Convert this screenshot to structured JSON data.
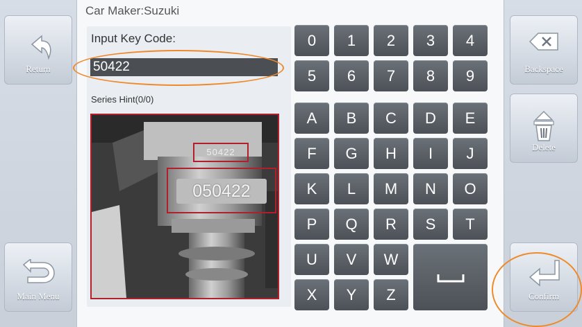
{
  "sidebar_left": {
    "return_label": "Return",
    "main_menu_label": "Main Menu"
  },
  "sidebar_right": {
    "backspace_label": "Backspace",
    "delete_label": "Delete",
    "confirm_label": "Confirm"
  },
  "header": {
    "car_maker": "Car Maker:Suzuki"
  },
  "form": {
    "key_code_label": "Input Key Code:",
    "key_code_value": "50422",
    "series_hint": "Series Hint(0/0)"
  },
  "photo": {
    "small_code": "50422",
    "large_code": "050422"
  },
  "keyboard": {
    "digits": [
      "0",
      "1",
      "2",
      "3",
      "4",
      "5",
      "6",
      "7",
      "8",
      "9"
    ],
    "letters": [
      "A",
      "B",
      "C",
      "D",
      "E",
      "F",
      "G",
      "H",
      "I",
      "J",
      "K",
      "L",
      "M",
      "N",
      "O",
      "P",
      "Q",
      "R",
      "S",
      "T",
      "U",
      "V",
      "W",
      "X",
      "Y",
      "Z"
    ],
    "space_symbol": "␣"
  },
  "colors": {
    "highlight": "#ef8a2c",
    "key": "#565b61",
    "photo_box": "#b21e2b"
  }
}
